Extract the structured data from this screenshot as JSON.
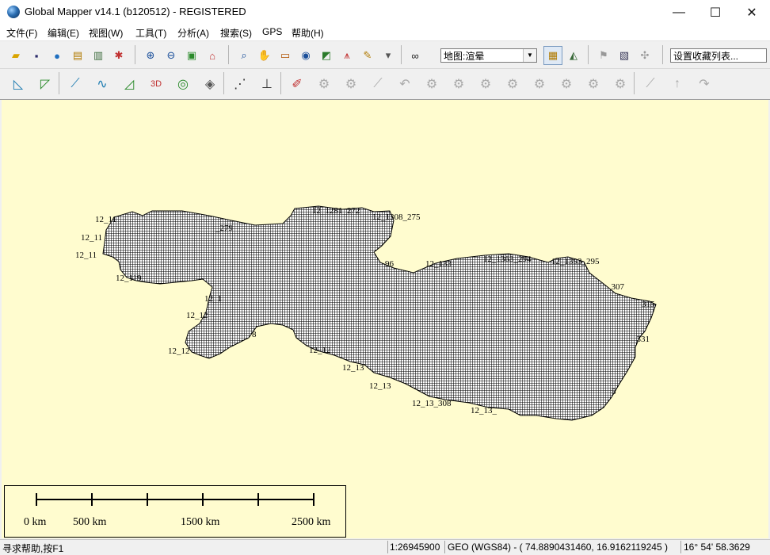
{
  "window": {
    "title": "Global Mapper v14.1 (b120512) - REGISTERED"
  },
  "window_controls": {
    "minimize": "—",
    "maximize": "☐",
    "close": "✕"
  },
  "menu": [
    "文件(F)",
    "编辑(E)",
    "视图(W)",
    "工具(T)",
    "分析(A)",
    "搜索(S)",
    "GPS",
    "帮助(H)"
  ],
  "toolbar": {
    "render_mode": "地图:渲晕",
    "favorites": "设置收藏列表..."
  },
  "map": {
    "labels": [
      "12_11",
      "12_11",
      "12_11",
      "12_1",
      "12_119",
      "12_1",
      "12_12",
      "12_12",
      "12_12",
      "12_13",
      "12_13",
      "12_13",
      "12_13_308",
      "12_13_",
      "12_1281_272",
      "12_1308_275",
      "_279",
      "96",
      "12_133",
      "12_1363_294",
      "12_1393_295",
      "_307",
      "315",
      "_331",
      "8",
      "5"
    ],
    "fill_color": "#000000",
    "background_color": "#fffccf"
  },
  "scale_bar": {
    "labels": [
      "0 km",
      "500 km",
      "1500 km",
      "2500 km"
    ]
  },
  "status": {
    "help": "寻求帮助,按F1",
    "scale": "1:26945900",
    "projection": "GEO (WGS84) - ( 74.8890431460, 16.9162119245 )",
    "dms": "16° 54' 58.3629"
  }
}
